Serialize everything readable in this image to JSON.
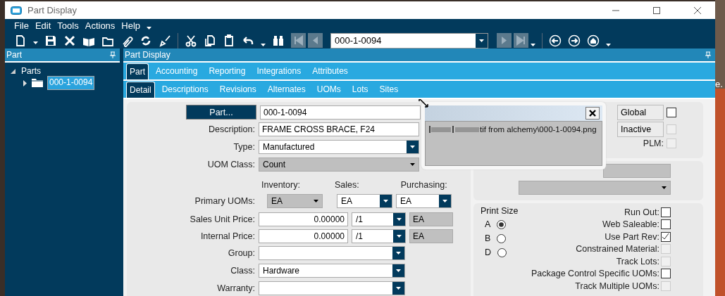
{
  "window": {
    "title": "Part Display"
  },
  "menu": [
    "File",
    "Edit",
    "Tools",
    "Actions",
    "Help"
  ],
  "toolbar": {
    "record": "000-1-0094"
  },
  "left_panel": {
    "title": "Part",
    "tree": [
      {
        "label": "Parts",
        "expanded": true,
        "children": [
          {
            "label": "000-1-0094",
            "selected": true,
            "expanded": false
          }
        ]
      }
    ]
  },
  "main_panel": {
    "title": "Part Display"
  },
  "tabs": [
    {
      "label": "Part",
      "selected": true
    },
    {
      "label": "Accounting",
      "selected": false
    },
    {
      "label": "Reporting",
      "selected": false
    },
    {
      "label": "Integrations",
      "selected": false
    },
    {
      "label": "Attributes",
      "selected": false
    }
  ],
  "subtabs": [
    {
      "label": "Detail",
      "selected": true
    },
    {
      "label": "Descriptions",
      "selected": false
    },
    {
      "label": "Revisions",
      "selected": false
    },
    {
      "label": "Alternates",
      "selected": false
    },
    {
      "label": "UOMs",
      "selected": false
    },
    {
      "label": "Lots",
      "selected": false
    },
    {
      "label": "Sites",
      "selected": false
    }
  ],
  "form_rows": [
    {
      "kind": "part",
      "button": "Part...",
      "value": "000-1-0094"
    },
    {
      "kind": "text",
      "label": "Description:",
      "value": "FRAME CROSS BRACE, F24"
    },
    {
      "kind": "select",
      "label": "Type:",
      "value": "Manufactured",
      "disabled": false
    },
    {
      "kind": "select",
      "label": "UOM Class:",
      "value": "Count",
      "disabled": true
    },
    {
      "kind": "headers",
      "headers": [
        "Inventory:",
        "Sales:",
        "Purchasing:"
      ]
    },
    {
      "kind": "uoms",
      "label": "Primary UOMs:",
      "selects": [
        {
          "value": "EA",
          "disabled": true
        },
        {
          "value": "EA",
          "disabled": false
        },
        {
          "value": "EA",
          "disabled": false
        }
      ]
    },
    {
      "kind": "price",
      "label": "Sales Unit Price:",
      "value": "0.00000",
      "per": "/1",
      "unit": "EA"
    },
    {
      "kind": "price",
      "label": "Internal Price:",
      "value": "0.00000",
      "per": "/1",
      "unit": "EA"
    },
    {
      "kind": "select",
      "label": "Group:",
      "disabled": false
    },
    {
      "kind": "select",
      "label": "Class:",
      "value": "Hardware",
      "disabled": false
    },
    {
      "kind": "select",
      "label": "Warranty:",
      "disabled": false
    }
  ],
  "popup": {
    "path": "tif from alchemy\\000-1-0094.png"
  },
  "flags": [
    {
      "kind": "button",
      "label": "Global",
      "checked": false,
      "disabled": false
    },
    {
      "kind": "button",
      "label": "Inactive",
      "checked": false,
      "disabled": true
    },
    {
      "kind": "label",
      "label": "PLM:",
      "checked": false,
      "disabled": true
    }
  ],
  "print_size": {
    "title": "Print Size",
    "options": [
      {
        "label": "A",
        "selected": true
      },
      {
        "label": "B",
        "selected": false
      },
      {
        "label": "D",
        "selected": false
      }
    ]
  },
  "options": [
    {
      "label": "Run Out:",
      "checked": false,
      "disabled": false
    },
    {
      "label": "Web Saleable:",
      "checked": false,
      "disabled": false
    },
    {
      "label": "Use Part Rev:",
      "checked": true,
      "disabled": false
    },
    {
      "label": "Constrained Material:",
      "checked": false,
      "disabled": true
    },
    {
      "label": "Track Lots:",
      "checked": false,
      "disabled": true
    },
    {
      "label": "Package Control Specific UOMs:",
      "checked": false,
      "disabled": false
    },
    {
      "label": "Track Multiple UOMs:",
      "checked": false,
      "disabled": true
    }
  ],
  "desktop_text": "e."
}
